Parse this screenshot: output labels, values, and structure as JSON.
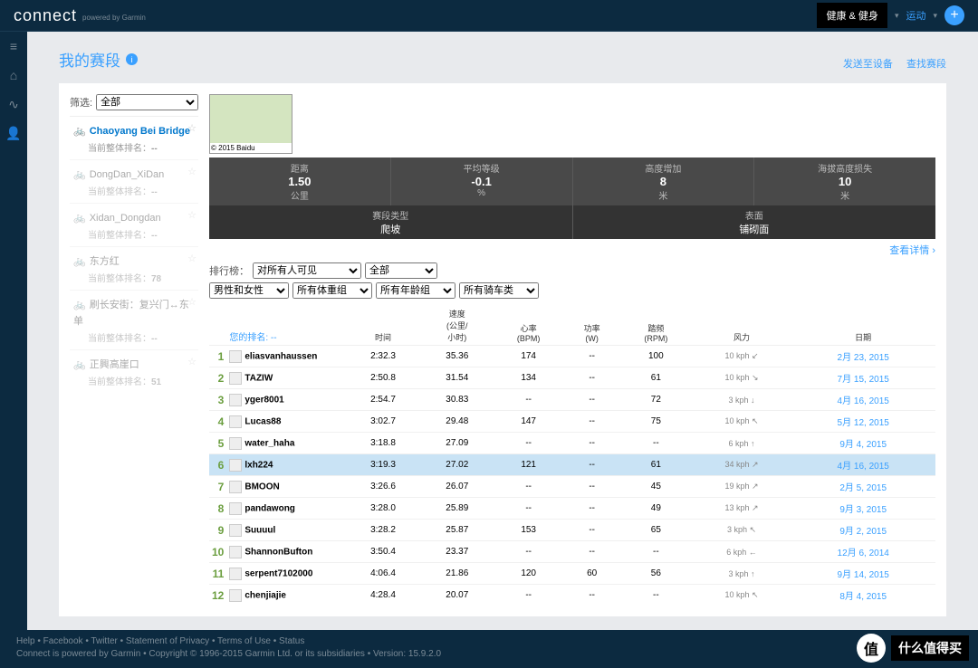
{
  "brand": "connect",
  "brand_sub": "powered by Garmin",
  "topbar": {
    "health": "健康 & 健身",
    "sport": "运动"
  },
  "page": {
    "title": "我的赛段",
    "send": "发送至设备",
    "find": "查找赛段"
  },
  "filter_label": "筛选:",
  "filter_all": "全部",
  "segments": [
    {
      "name": "Chaoyang Bei Bridge",
      "rank": "--",
      "active": true
    },
    {
      "name": "DongDan_XiDan",
      "rank": "--"
    },
    {
      "name": "Xidan_Dongdan",
      "rank": "--"
    },
    {
      "name": "东方红",
      "rank": "78"
    },
    {
      "name": "刷长安街：复兴门↔东单",
      "rank": "--"
    },
    {
      "name": "正興高崖口",
      "rank": "51"
    }
  ],
  "rank_label": "当前整体排名：",
  "stats": [
    {
      "label": "距离",
      "val": "1.50",
      "unit": "公里"
    },
    {
      "label": "平均等级",
      "val": "-0.1",
      "unit": "%"
    },
    {
      "label": "高度增加",
      "val": "8",
      "unit": "米"
    },
    {
      "label": "海拔高度损失",
      "val": "10",
      "unit": "米"
    }
  ],
  "stats2": [
    {
      "label": "赛段类型",
      "val": "爬坡"
    },
    {
      "label": "表面",
      "val": "铺砌面"
    }
  ],
  "detail": "查看详情 ›",
  "rank_title": "排行榜：",
  "rank_sel1": "对所有人可见",
  "rank_sel2": "全部",
  "f2": [
    "男性和女性",
    "所有体重组",
    "所有年龄组",
    "所有骑车类"
  ],
  "your_rank": "您的排名: --",
  "cols": {
    "c2": "",
    "c3": "时间",
    "c4": "速度\n(公里/\n小时)",
    "c5": "心率\n(BPM)",
    "c6": "功率\n(W)",
    "c7": "踏频\n(RPM)",
    "c8": "风力",
    "c9": "日期"
  },
  "rows": [
    {
      "n": 1,
      "name": "eliasvanhaussen",
      "t": "2:32.3",
      "s": "35.36",
      "hr": "174",
      "p": "--",
      "c": "100",
      "w": "10 kph ↙",
      "d": "2月 23, 2015"
    },
    {
      "n": 2,
      "name": "TAZIW",
      "t": "2:50.8",
      "s": "31.54",
      "hr": "134",
      "p": "--",
      "c": "61",
      "w": "10 kph ↘",
      "d": "7月 15, 2015"
    },
    {
      "n": 3,
      "name": "yger8001",
      "t": "2:54.7",
      "s": "30.83",
      "hr": "--",
      "p": "--",
      "c": "72",
      "w": "3 kph ↓",
      "d": "4月 16, 2015"
    },
    {
      "n": 4,
      "name": "Lucas88",
      "t": "3:02.7",
      "s": "29.48",
      "hr": "147",
      "p": "--",
      "c": "75",
      "w": "10 kph ↖",
      "d": "5月 12, 2015"
    },
    {
      "n": 5,
      "name": "water_haha",
      "t": "3:18.8",
      "s": "27.09",
      "hr": "--",
      "p": "--",
      "c": "--",
      "w": "6 kph ↑",
      "d": "9月 4, 2015"
    },
    {
      "n": 6,
      "name": "lxh224",
      "t": "3:19.3",
      "s": "27.02",
      "hr": "121",
      "p": "--",
      "c": "61",
      "w": "34 kph ↗",
      "d": "4月 16, 2015",
      "hl": true
    },
    {
      "n": 7,
      "name": "BMOON",
      "t": "3:26.6",
      "s": "26.07",
      "hr": "--",
      "p": "--",
      "c": "45",
      "w": "19 kph ↗",
      "d": "2月 5, 2015"
    },
    {
      "n": 8,
      "name": "pandawong",
      "t": "3:28.0",
      "s": "25.89",
      "hr": "--",
      "p": "--",
      "c": "49",
      "w": "13 kph ↗",
      "d": "9月 3, 2015"
    },
    {
      "n": 9,
      "name": "Suuuul",
      "t": "3:28.2",
      "s": "25.87",
      "hr": "153",
      "p": "--",
      "c": "65",
      "w": "3 kph ↖",
      "d": "9月 2, 2015"
    },
    {
      "n": 10,
      "name": "ShannonBufton",
      "t": "3:50.4",
      "s": "23.37",
      "hr": "--",
      "p": "--",
      "c": "--",
      "w": "6 kph ←",
      "d": "12月 6, 2014"
    },
    {
      "n": 11,
      "name": "serpent7102000",
      "t": "4:06.4",
      "s": "21.86",
      "hr": "120",
      "p": "60",
      "c": "56",
      "w": "3 kph ↑",
      "d": "9月 14, 2015"
    },
    {
      "n": 12,
      "name": "chenjiajie",
      "t": "4:28.4",
      "s": "20.07",
      "hr": "--",
      "p": "--",
      "c": "--",
      "w": "10 kph ↖",
      "d": "8月 4, 2015"
    }
  ],
  "footer": {
    "links": "Help • Facebook • Twitter • Statement of Privacy • Terms of Use • Status",
    "copy": "Connect is powered by Garmin • Copyright © 1996-2015 Garmin Ltd. or its subsidiaries • Version: 15.9.2.0"
  },
  "wm": {
    "badge": "值",
    "text": "什么值得买"
  }
}
